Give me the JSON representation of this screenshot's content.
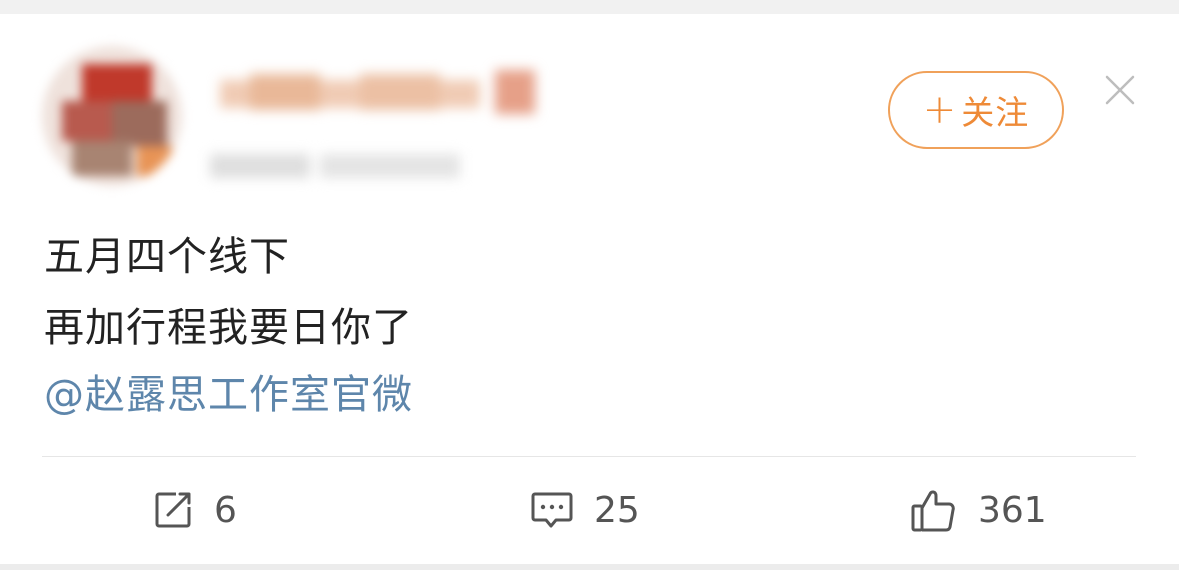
{
  "post": {
    "follow_button": {
      "plus": "+",
      "label": "关注"
    },
    "text_lines": [
      "五月四个线下",
      "再加行程我要日你了"
    ],
    "mention": "@赵露思工作室官微"
  },
  "actions": {
    "repost_count": "6",
    "comment_count": "25",
    "like_count": "361"
  },
  "colors": {
    "follow_accent": "#ee8a37",
    "mention_link": "#5e86ab",
    "text": "#222222",
    "icon": "#555555"
  },
  "icons": [
    "close-icon",
    "repost-icon",
    "comment-icon",
    "like-icon"
  ]
}
